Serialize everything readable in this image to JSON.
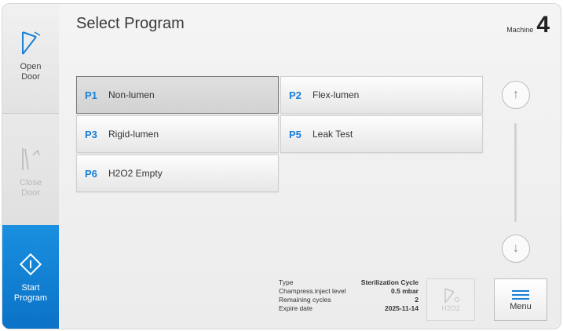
{
  "sidebar": {
    "open_door": {
      "line1": "Open",
      "line2": "Door",
      "icon": "open-door-icon"
    },
    "close_door": {
      "line1": "Close",
      "line2": "Door",
      "icon": "close-door-icon",
      "state": "disabled"
    },
    "start_program": {
      "line1": "Start",
      "line2": "Program",
      "icon": "start-diamond-icon"
    }
  },
  "header": {
    "title": "Select Program",
    "machine_label": "Machine",
    "machine_number": "4"
  },
  "programs": [
    {
      "id": "P1",
      "name": "Non-lumen",
      "selected": true
    },
    {
      "id": "P2",
      "name": "Flex-lumen",
      "selected": false
    },
    {
      "id": "P3",
      "name": "Rigid-lumen",
      "selected": false
    },
    {
      "id": "P5",
      "name": "Leak Test",
      "selected": false
    },
    {
      "id": "P6",
      "name": "H2O2 Empty",
      "selected": false
    }
  ],
  "info": {
    "type_label": "Type",
    "type_value": "Sterilization Cycle",
    "pressure_label": "Champress.inject level",
    "pressure_value": "0.5 mbar",
    "cycles_label": "Remaining cycles",
    "cycles_value": "2",
    "expire_label": "Expire date",
    "expire_value": "2025-11-14"
  },
  "actions": {
    "h2o2_label": "H2O2",
    "menu_label": "Menu"
  },
  "colors": {
    "accent": "#1a7fd6",
    "start_button": "#0b72c6"
  }
}
